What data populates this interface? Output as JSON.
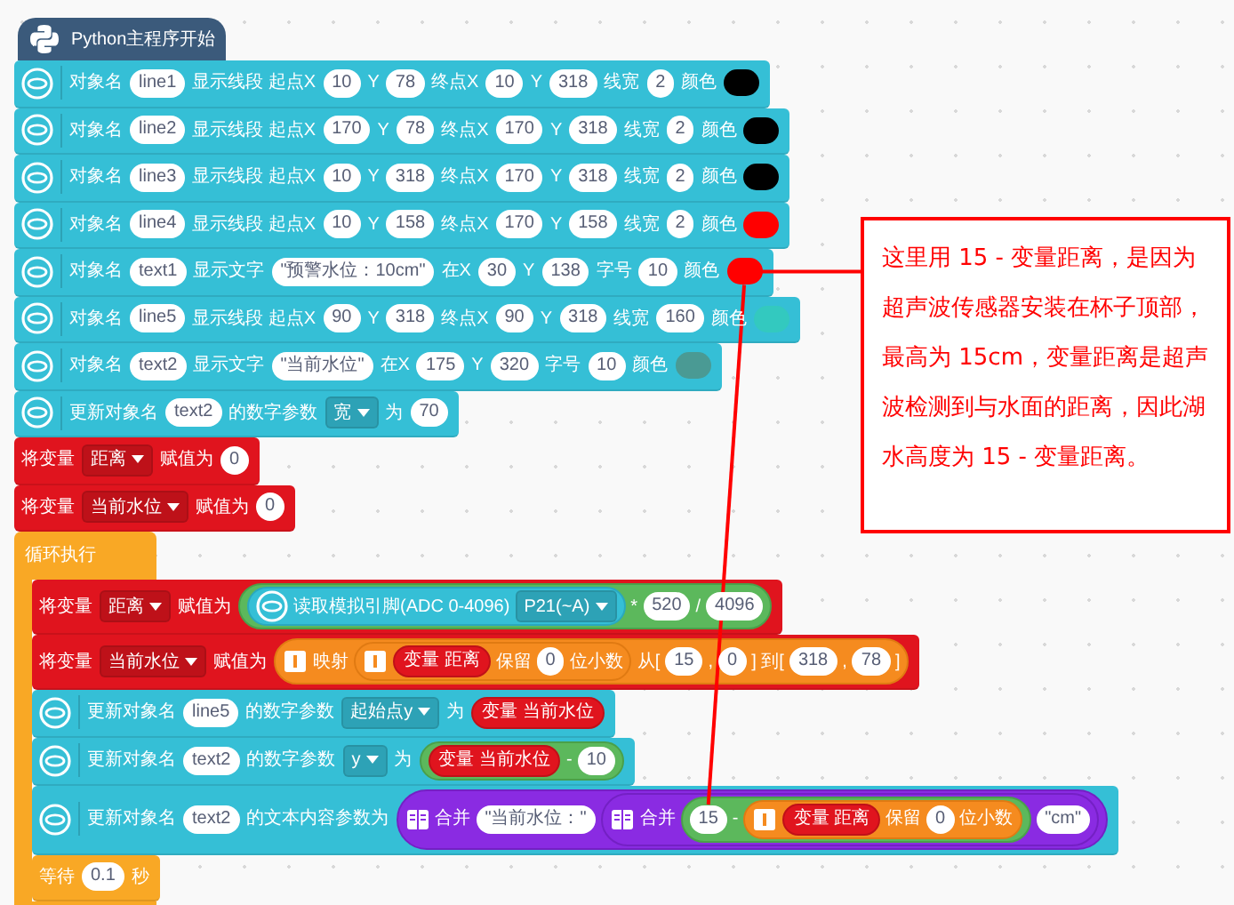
{
  "hat": {
    "label": "Python主程序开始"
  },
  "blocks": [
    {
      "kind": "unihiker",
      "parts": [
        {
          "kind": "text",
          "text": "对象名"
        },
        {
          "kind": "field",
          "text": "line1"
        },
        {
          "kind": "text",
          "text": "显示线段 起点X"
        },
        {
          "kind": "field",
          "text": "10"
        },
        {
          "kind": "text",
          "text": "Y"
        },
        {
          "kind": "field",
          "text": "78"
        },
        {
          "kind": "text",
          "text": "终点X"
        },
        {
          "kind": "field",
          "text": "10"
        },
        {
          "kind": "text",
          "text": "Y"
        },
        {
          "kind": "field",
          "text": "318"
        },
        {
          "kind": "text",
          "text": "线宽"
        },
        {
          "kind": "field",
          "text": "2"
        },
        {
          "kind": "text",
          "text": "颜色"
        },
        {
          "kind": "color",
          "color": "#000000"
        }
      ]
    },
    {
      "kind": "unihiker",
      "parts": [
        {
          "kind": "text",
          "text": "对象名"
        },
        {
          "kind": "field",
          "text": "line2"
        },
        {
          "kind": "text",
          "text": "显示线段 起点X"
        },
        {
          "kind": "field",
          "text": "170"
        },
        {
          "kind": "text",
          "text": "Y"
        },
        {
          "kind": "field",
          "text": "78"
        },
        {
          "kind": "text",
          "text": "终点X"
        },
        {
          "kind": "field",
          "text": "170"
        },
        {
          "kind": "text",
          "text": "Y"
        },
        {
          "kind": "field",
          "text": "318"
        },
        {
          "kind": "text",
          "text": "线宽"
        },
        {
          "kind": "field",
          "text": "2"
        },
        {
          "kind": "text",
          "text": "颜色"
        },
        {
          "kind": "color",
          "color": "#000000"
        }
      ]
    },
    {
      "kind": "unihiker",
      "parts": [
        {
          "kind": "text",
          "text": "对象名"
        },
        {
          "kind": "field",
          "text": "line3"
        },
        {
          "kind": "text",
          "text": "显示线段 起点X"
        },
        {
          "kind": "field",
          "text": "10"
        },
        {
          "kind": "text",
          "text": "Y"
        },
        {
          "kind": "field",
          "text": "318"
        },
        {
          "kind": "text",
          "text": "终点X"
        },
        {
          "kind": "field",
          "text": "170"
        },
        {
          "kind": "text",
          "text": "Y"
        },
        {
          "kind": "field",
          "text": "318"
        },
        {
          "kind": "text",
          "text": "线宽"
        },
        {
          "kind": "field",
          "text": "2"
        },
        {
          "kind": "text",
          "text": "颜色"
        },
        {
          "kind": "color",
          "color": "#000000"
        }
      ]
    },
    {
      "kind": "unihiker",
      "parts": [
        {
          "kind": "text",
          "text": "对象名"
        },
        {
          "kind": "field",
          "text": "line4"
        },
        {
          "kind": "text",
          "text": "显示线段 起点X"
        },
        {
          "kind": "field",
          "text": "10"
        },
        {
          "kind": "text",
          "text": "Y"
        },
        {
          "kind": "field",
          "text": "158"
        },
        {
          "kind": "text",
          "text": "终点X"
        },
        {
          "kind": "field",
          "text": "170"
        },
        {
          "kind": "text",
          "text": "Y"
        },
        {
          "kind": "field",
          "text": "158"
        },
        {
          "kind": "text",
          "text": "线宽"
        },
        {
          "kind": "field",
          "text": "2"
        },
        {
          "kind": "text",
          "text": "颜色"
        },
        {
          "kind": "color",
          "color": "#ff0000"
        }
      ]
    },
    {
      "kind": "unihiker",
      "parts": [
        {
          "kind": "text",
          "text": "对象名"
        },
        {
          "kind": "field",
          "text": "text1"
        },
        {
          "kind": "text",
          "text": "显示文字"
        },
        {
          "kind": "string",
          "text": "\"预警水位：10cm\""
        },
        {
          "kind": "text",
          "text": "在X"
        },
        {
          "kind": "field",
          "text": "30"
        },
        {
          "kind": "text",
          "text": "Y"
        },
        {
          "kind": "field",
          "text": "138"
        },
        {
          "kind": "text",
          "text": "字号"
        },
        {
          "kind": "field",
          "text": "10"
        },
        {
          "kind": "text",
          "text": "颜色"
        },
        {
          "kind": "color",
          "color": "#ff0000",
          "callout": true
        }
      ]
    },
    {
      "kind": "unihiker",
      "parts": [
        {
          "kind": "text",
          "text": "对象名"
        },
        {
          "kind": "field",
          "text": "line5"
        },
        {
          "kind": "text",
          "text": "显示线段 起点X"
        },
        {
          "kind": "field",
          "text": "90"
        },
        {
          "kind": "text",
          "text": "Y"
        },
        {
          "kind": "field",
          "text": "318"
        },
        {
          "kind": "text",
          "text": "终点X"
        },
        {
          "kind": "field",
          "text": "90"
        },
        {
          "kind": "text",
          "text": "Y"
        },
        {
          "kind": "field",
          "text": "318"
        },
        {
          "kind": "text",
          "text": "线宽"
        },
        {
          "kind": "field",
          "text": "160"
        },
        {
          "kind": "text",
          "text": "颜色"
        },
        {
          "kind": "color",
          "color": "#33c9bf"
        }
      ]
    },
    {
      "kind": "unihiker",
      "parts": [
        {
          "kind": "text",
          "text": "对象名"
        },
        {
          "kind": "field",
          "text": "text2"
        },
        {
          "kind": "text",
          "text": "显示文字"
        },
        {
          "kind": "string",
          "text": "\"当前水位\""
        },
        {
          "kind": "text",
          "text": "在X"
        },
        {
          "kind": "field",
          "text": "175"
        },
        {
          "kind": "text",
          "text": "Y"
        },
        {
          "kind": "field",
          "text": "320"
        },
        {
          "kind": "text",
          "text": "字号"
        },
        {
          "kind": "field",
          "text": "10"
        },
        {
          "kind": "text",
          "text": "颜色"
        },
        {
          "kind": "color",
          "color": "#4a9a94"
        }
      ]
    },
    {
      "kind": "unihiker",
      "parts": [
        {
          "kind": "text",
          "text": "更新对象名"
        },
        {
          "kind": "field",
          "text": "text2"
        },
        {
          "kind": "text",
          "text": "的数字参数"
        },
        {
          "kind": "dropdown",
          "text": "宽"
        },
        {
          "kind": "text",
          "text": "为"
        },
        {
          "kind": "field",
          "text": "70"
        }
      ]
    },
    {
      "kind": "variable",
      "parts": [
        {
          "kind": "text",
          "text": "将变量"
        },
        {
          "kind": "dropdown",
          "text": "距离"
        },
        {
          "kind": "text",
          "text": "赋值为"
        },
        {
          "kind": "field",
          "text": "0"
        }
      ]
    },
    {
      "kind": "variable",
      "parts": [
        {
          "kind": "text",
          "text": "将变量"
        },
        {
          "kind": "dropdown",
          "text": "当前水位"
        },
        {
          "kind": "text",
          "text": "赋值为"
        },
        {
          "kind": "field",
          "text": "0"
        }
      ]
    },
    {
      "kind": "loop",
      "label": "循环执行",
      "body": [
        {
          "kind": "variable",
          "parts": [
            {
              "kind": "text",
              "text": "将变量"
            },
            {
              "kind": "dropdown",
              "text": "距离"
            },
            {
              "kind": "text",
              "text": "赋值为"
            },
            {
              "kind": "math",
              "parts": [
                {
                  "kind": "sensor",
                  "parts": [
                    {
                      "kind": "text",
                      "text": "读取模拟引脚(ADC 0-4096)"
                    },
                    {
                      "kind": "dropdown",
                      "text": "P21(~A)"
                    }
                  ]
                },
                {
                  "kind": "text",
                  "text": "*"
                },
                {
                  "kind": "field",
                  "text": "520"
                },
                {
                  "kind": "text",
                  "text": "/"
                },
                {
                  "kind": "field",
                  "text": "4096"
                }
              ]
            }
          ]
        },
        {
          "kind": "variable",
          "parts": [
            {
              "kind": "text",
              "text": "将变量"
            },
            {
              "kind": "dropdown",
              "text": "当前水位"
            },
            {
              "kind": "text",
              "text": "赋值为"
            },
            {
              "kind": "operator",
              "parts": [
                {
                  "kind": "text",
                  "text": "映射"
                },
                {
                  "kind": "operator",
                  "parts": [
                    {
                      "kind": "variable",
                      "text": "变量 距离"
                    },
                    {
                      "kind": "text",
                      "text": "保留"
                    },
                    {
                      "kind": "field",
                      "text": "0"
                    },
                    {
                      "kind": "text",
                      "text": "位小数"
                    }
                  ]
                },
                {
                  "kind": "text",
                  "text": "从["
                },
                {
                  "kind": "field",
                  "text": "15"
                },
                {
                  "kind": "text",
                  "text": ","
                },
                {
                  "kind": "field",
                  "text": "0"
                },
                {
                  "kind": "text",
                  "text": "] 到["
                },
                {
                  "kind": "field",
                  "text": "318"
                },
                {
                  "kind": "text",
                  "text": ","
                },
                {
                  "kind": "field",
                  "text": "78"
                },
                {
                  "kind": "text",
                  "text": "]"
                }
              ]
            }
          ]
        },
        {
          "kind": "unihiker",
          "parts": [
            {
              "kind": "text",
              "text": "更新对象名"
            },
            {
              "kind": "field",
              "text": "line5"
            },
            {
              "kind": "text",
              "text": "的数字参数"
            },
            {
              "kind": "dropdown",
              "text": "起始点y"
            },
            {
              "kind": "text",
              "text": "为"
            },
            {
              "kind": "variable",
              "text": "变量 当前水位"
            }
          ]
        },
        {
          "kind": "unihiker",
          "parts": [
            {
              "kind": "text",
              "text": "更新对象名"
            },
            {
              "kind": "field",
              "text": "text2"
            },
            {
              "kind": "text",
              "text": "的数字参数"
            },
            {
              "kind": "dropdown",
              "text": "y"
            },
            {
              "kind": "text",
              "text": "为"
            },
            {
              "kind": "math",
              "parts": [
                {
                  "kind": "variable",
                  "text": "变量 当前水位"
                },
                {
                  "kind": "text",
                  "text": "-"
                },
                {
                  "kind": "field",
                  "text": "10"
                }
              ]
            }
          ]
        },
        {
          "kind": "unihiker",
          "parts": [
            {
              "kind": "text",
              "text": "更新对象名"
            },
            {
              "kind": "field",
              "text": "text2"
            },
            {
              "kind": "text",
              "text": "的文本内容参数为"
            },
            {
              "kind": "join",
              "parts": [
                {
                  "kind": "text",
                  "text": "合并"
                },
                {
                  "kind": "string",
                  "text": "\"当前水位：\""
                },
                {
                  "kind": "join",
                  "parts": [
                    {
                      "kind": "text",
                      "text": "合并"
                    },
                    {
                      "kind": "math",
                      "parts": [
                        {
                          "kind": "field",
                          "text": "15",
                          "callout": true
                        },
                        {
                          "kind": "text",
                          "text": "-"
                        },
                        {
                          "kind": "operator",
                          "parts": [
                            {
                              "kind": "variable",
                              "text": "变量 距离"
                            },
                            {
                              "kind": "text",
                              "text": "保留"
                            },
                            {
                              "kind": "field",
                              "text": "0"
                            },
                            {
                              "kind": "text",
                              "text": "位小数"
                            }
                          ]
                        }
                      ]
                    },
                    {
                      "kind": "string",
                      "text": "\"cm\""
                    }
                  ]
                }
              ]
            }
          ]
        },
        {
          "kind": "control",
          "parts": [
            {
              "kind": "text",
              "text": "等待"
            },
            {
              "kind": "field",
              "text": "0.1"
            },
            {
              "kind": "text",
              "text": "秒"
            }
          ]
        }
      ]
    }
  ],
  "annotation": {
    "text": "这里用 15 -  变量距离，是因为超声波传感器安装在杯子顶部，最高为 15cm，变量距离是超声波检测到与水面的距离，因此湖水高度为 15 - 变量距离。"
  }
}
